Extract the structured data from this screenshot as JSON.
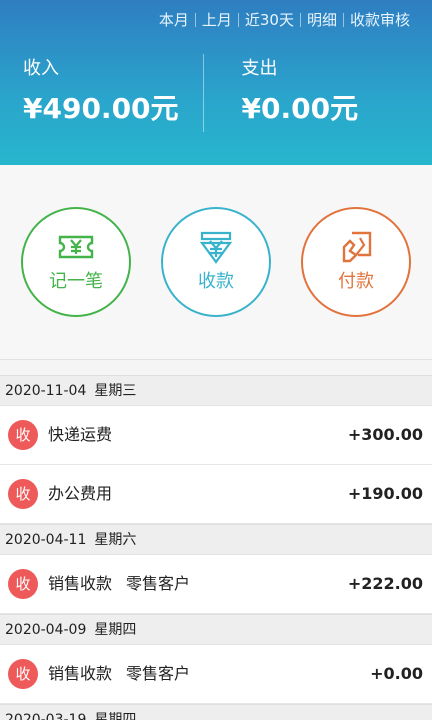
{
  "filters": [
    "本月",
    "上月",
    "近30天",
    "明细",
    "收款审核"
  ],
  "summary": {
    "income_label": "收入",
    "income_value": "¥490.00元",
    "expense_label": "支出",
    "expense_value": "¥0.00元"
  },
  "actions": {
    "record": "记一笔",
    "receive": "收款",
    "pay": "付款"
  },
  "groups": [
    {
      "date": "2020-11-04",
      "weekday": "星期三",
      "entries": [
        {
          "badge": "收",
          "title": "快递运费",
          "customer": "",
          "amount": "+300.00"
        },
        {
          "badge": "收",
          "title": "办公费用",
          "customer": "",
          "amount": "+190.00"
        }
      ]
    },
    {
      "date": "2020-04-11",
      "weekday": "星期六",
      "entries": [
        {
          "badge": "收",
          "title": "销售收款",
          "customer": "零售客户",
          "amount": "+222.00"
        }
      ]
    },
    {
      "date": "2020-04-09",
      "weekday": "星期四",
      "entries": [
        {
          "badge": "收",
          "title": "销售收款",
          "customer": "零售客户",
          "amount": "+0.00"
        }
      ]
    },
    {
      "date": "2020-03-19",
      "weekday": "星期四",
      "entries": []
    }
  ],
  "colors": {
    "header_top": "#2f7ec1",
    "header_bottom": "#27b6cc",
    "green": "#43b34a",
    "teal": "#39b3cc",
    "orange": "#e1733d",
    "badge_red": "#ee5a5a"
  },
  "icons": {
    "record": "ticket-yuan-icon",
    "receive": "yuan-download-icon",
    "pay": "hand-card-icon"
  }
}
